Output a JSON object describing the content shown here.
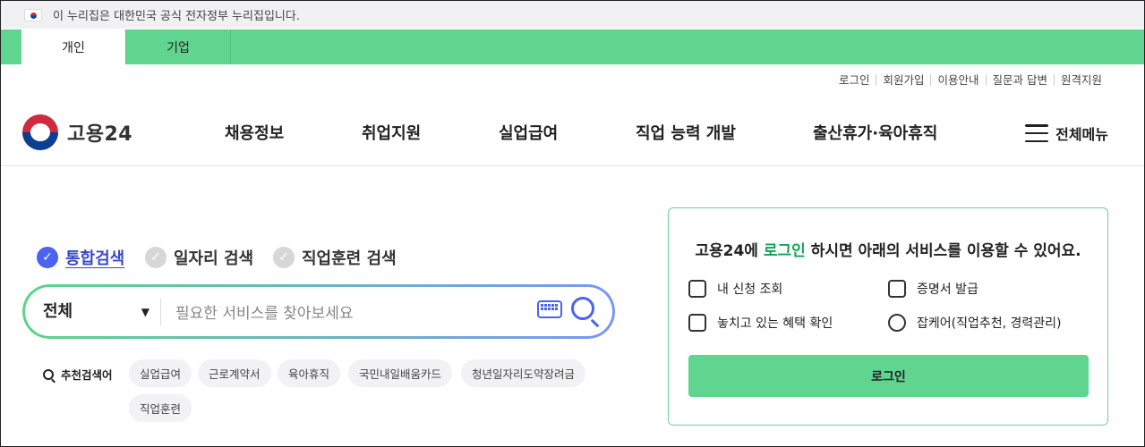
{
  "gov_banner": {
    "text": "이 누리집은 대한민국 공식 전자정부 누리집입니다."
  },
  "tabs": [
    {
      "label": "개인"
    },
    {
      "label": "기업"
    }
  ],
  "util_links": [
    "로그인",
    "회원가입",
    "이용안내",
    "질문과 답변",
    "원격지원"
  ],
  "logo": {
    "text": "고용24"
  },
  "gnb": [
    "채용정보",
    "취업지원",
    "실업급여",
    "직업 능력 개발",
    "출산휴가·육아휴직"
  ],
  "all_menu": "전체메뉴",
  "search_types": [
    {
      "label": "통합검색",
      "active": true
    },
    {
      "label": "일자리 검색",
      "active": false
    },
    {
      "label": "직업훈련 검색",
      "active": false
    }
  ],
  "search": {
    "scope": "전체",
    "placeholder": "필요한 서비스를 찾아보세요"
  },
  "recommended": {
    "label": "추천검색어",
    "keywords": [
      "실업급여",
      "근로계약서",
      "육아휴직",
      "국민내일배움카드",
      "청년일자리도약장려금",
      "직업훈련"
    ]
  },
  "login_card": {
    "title_pre": "고용24에 ",
    "title_hl": "로그인",
    "title_post": " 하시면 아래의 서비스를 이용할 수 있어요.",
    "services": [
      "내 신청 조회",
      "증명서 발급",
      "놓치고 있는 혜택 확인",
      "잡케어(직업추천, 경력관리)"
    ],
    "button": "로그인"
  },
  "colors": {
    "green": "#5fd58f",
    "blue": "#4c62f0",
    "highlight": "#16a05a"
  }
}
